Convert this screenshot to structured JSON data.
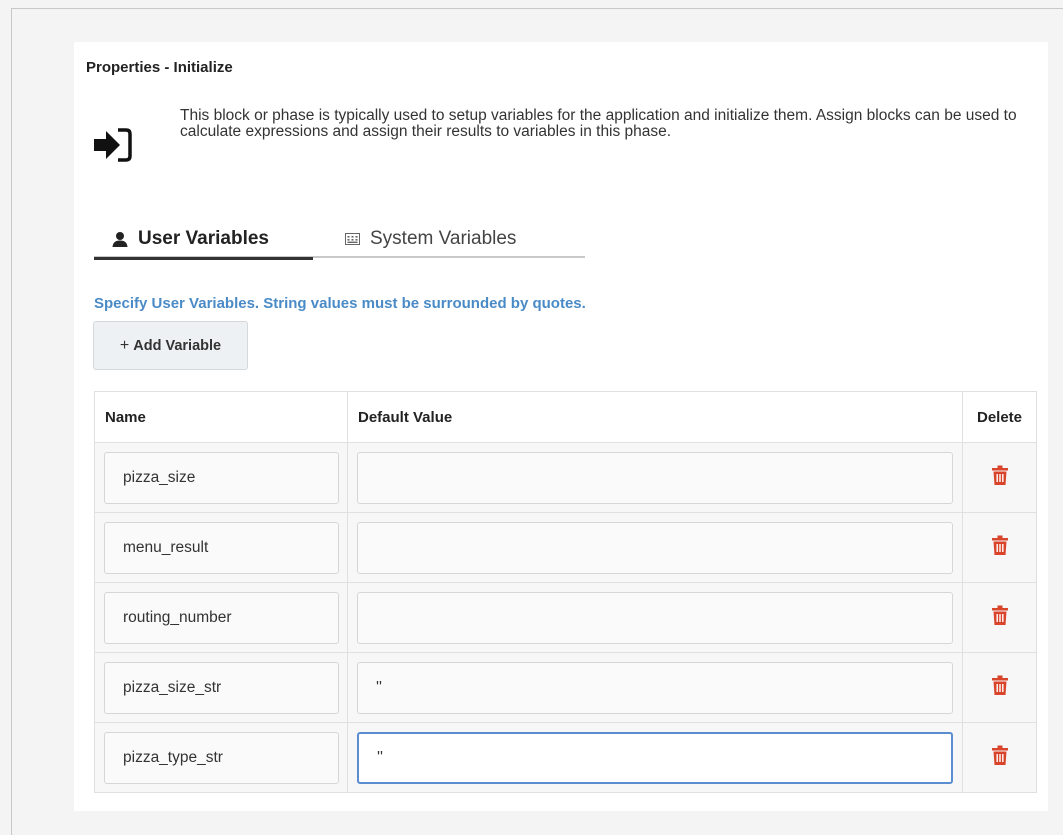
{
  "panel": {
    "title": "Properties - Initialize",
    "description": "This block or phase is typically used to setup variables for the application and initialize them. Assign blocks can be used to calculate expressions and assign their results to variables in this phase."
  },
  "tabs": [
    {
      "label": "User Variables",
      "icon": "user-icon",
      "active": true
    },
    {
      "label": "System Variables",
      "icon": "keyboard-icon",
      "active": false
    }
  ],
  "hint": "Specify User Variables. String values must be surrounded by quotes.",
  "add_button": {
    "plus": "+",
    "label": "Add Variable"
  },
  "table": {
    "headers": {
      "name": "Name",
      "value": "Default Value",
      "delete": "Delete"
    },
    "rows": [
      {
        "name": "pizza_size",
        "value": ""
      },
      {
        "name": "menu_result",
        "value": ""
      },
      {
        "name": "routing_number",
        "value": ""
      },
      {
        "name": "pizza_size_str",
        "value": "''"
      },
      {
        "name": "pizza_type_str",
        "value": "''"
      }
    ]
  },
  "colors": {
    "accent_blue": "#4a8bc7",
    "focus_border": "#5b8ed0",
    "delete_red": "#d9452b"
  }
}
